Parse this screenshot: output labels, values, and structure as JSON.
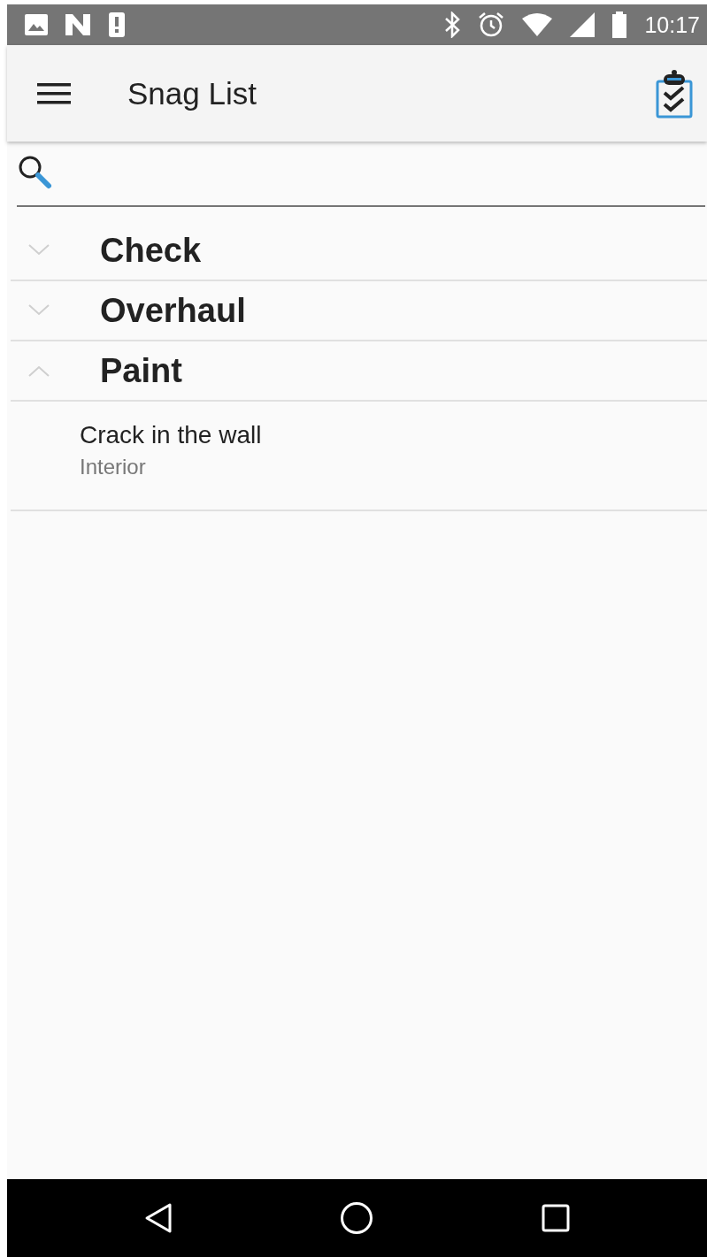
{
  "status_bar": {
    "time": "10:17"
  },
  "app_bar": {
    "title": "Snag List"
  },
  "groups": [
    {
      "title": "Check",
      "expanded": false
    },
    {
      "title": "Overhaul",
      "expanded": false
    },
    {
      "title": "Paint",
      "expanded": true,
      "items": [
        {
          "title": "Crack in the wall",
          "subtitle": "Interior"
        }
      ]
    }
  ]
}
